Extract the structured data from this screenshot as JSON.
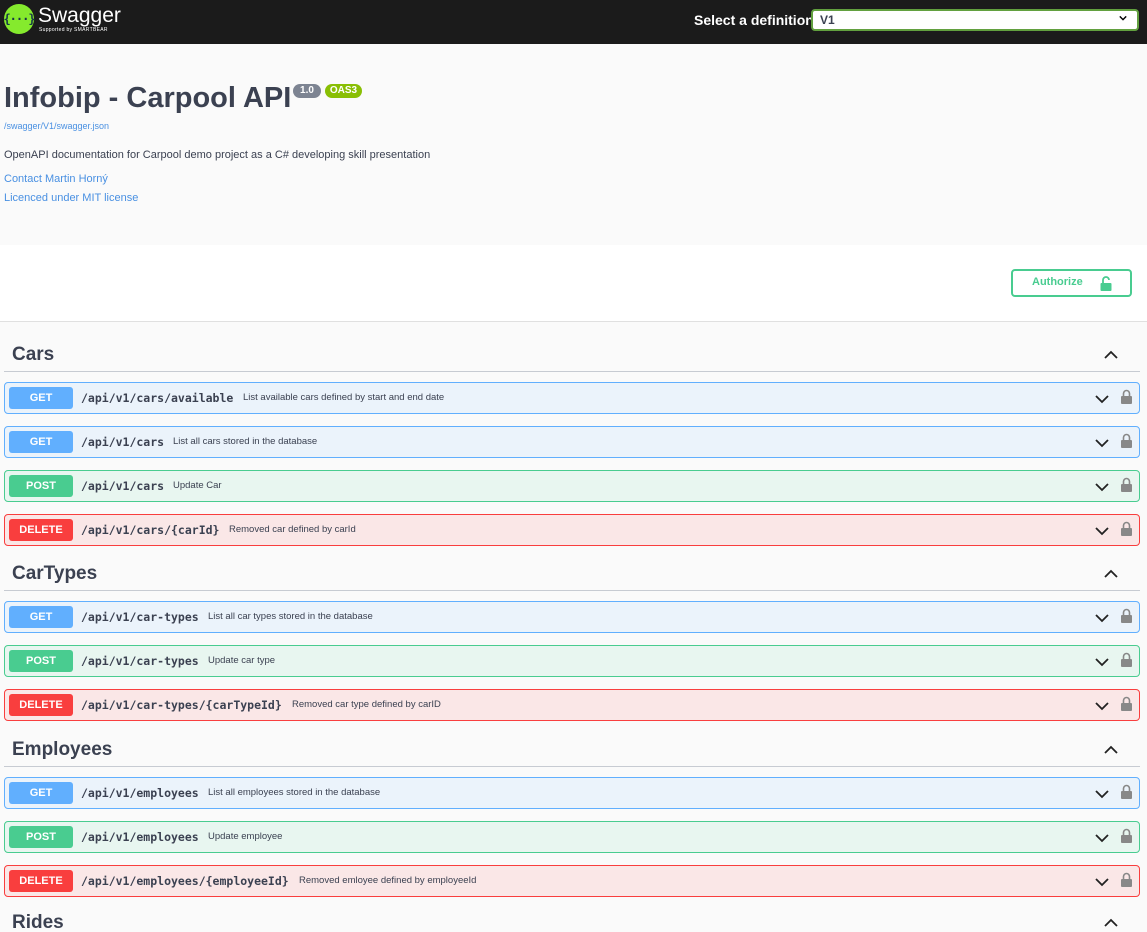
{
  "topbar": {
    "logo_title": "Swagger",
    "logo_sub": "Supported by SMARTBEAR",
    "logo_mark": "{···}",
    "definition_label": "Select a definition",
    "definition_value": "V1"
  },
  "info": {
    "title": "Infobip - Carpool API",
    "version": "1.0",
    "oas": "OAS3",
    "spec_url": "/swagger/V1/swagger.json",
    "description": "OpenAPI documentation for Carpool demo project as a C# developing skill presentation",
    "contact": "Contact Martin Horný",
    "license": "Licenced under MIT license"
  },
  "authorize": {
    "label": "Authorize"
  },
  "colors": {
    "get": "#61affe",
    "post": "#49cc90",
    "delete": "#f93e3e",
    "brand": "#85ea2d"
  },
  "sections": [
    {
      "name": "Cars",
      "ops": [
        {
          "method": "GET",
          "path": "/api/v1/cars/available",
          "summary": "List available cars defined by start and end date"
        },
        {
          "method": "GET",
          "path": "/api/v1/cars",
          "summary": "List all cars stored in the database"
        },
        {
          "method": "POST",
          "path": "/api/v1/cars",
          "summary": "Update Car"
        },
        {
          "method": "DELETE",
          "path": "/api/v1/cars/{carId}",
          "summary": "Removed car defined by carId"
        }
      ]
    },
    {
      "name": "CarTypes",
      "ops": [
        {
          "method": "GET",
          "path": "/api/v1/car-types",
          "summary": "List all car types stored in the database"
        },
        {
          "method": "POST",
          "path": "/api/v1/car-types",
          "summary": "Update car type"
        },
        {
          "method": "DELETE",
          "path": "/api/v1/car-types/{carTypeId}",
          "summary": "Removed car type defined by carID"
        }
      ]
    },
    {
      "name": "Employees",
      "ops": [
        {
          "method": "GET",
          "path": "/api/v1/employees",
          "summary": "List all employees stored in the database"
        },
        {
          "method": "POST",
          "path": "/api/v1/employees",
          "summary": "Update employee"
        },
        {
          "method": "DELETE",
          "path": "/api/v1/employees/{employeeId}",
          "summary": "Removed emloyee defined by employeeId"
        }
      ]
    },
    {
      "name": "Rides",
      "ops": []
    }
  ]
}
